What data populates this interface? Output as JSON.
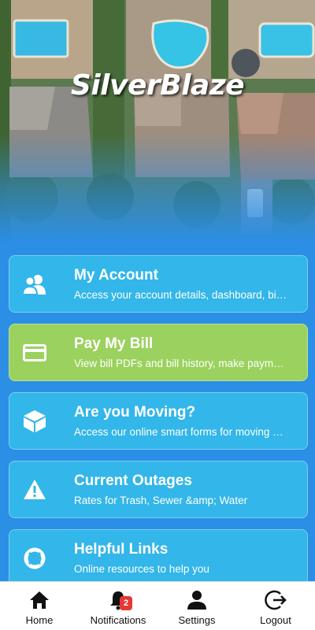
{
  "header": {
    "brand": "SilverBlaze"
  },
  "cards": [
    {
      "title": "My Account",
      "description": "Access your account details, dashboard, bi…",
      "icon": "users-icon",
      "color": "#33b6e9"
    },
    {
      "title": "Pay My Bill",
      "description": "View bill PDFs and bill history, make paym…",
      "icon": "credit-card-icon",
      "color": "#9bd15e"
    },
    {
      "title": "Are you Moving?",
      "description": "Access our online smart forms for moving …",
      "icon": "box-icon",
      "color": "#33b6e9"
    },
    {
      "title": "Current Outages",
      "description": "Rates for Trash, Sewer &amp; Water",
      "icon": "warning-icon",
      "color": "#33b6e9"
    },
    {
      "title": "Helpful Links",
      "description": "Online resources to help you",
      "icon": "lifebuoy-icon",
      "color": "#33b6e9"
    }
  ],
  "tabs": [
    {
      "label": "Home",
      "icon": "home-icon"
    },
    {
      "label": "Notifications",
      "icon": "bell-icon",
      "badge": "2"
    },
    {
      "label": "Settings",
      "icon": "person-icon"
    },
    {
      "label": "Logout",
      "icon": "logout-icon"
    }
  ],
  "colors": {
    "background": "#2b8fe6",
    "card_blue": "#33b6e9",
    "card_green": "#9bd15e",
    "badge": "#e53935"
  }
}
